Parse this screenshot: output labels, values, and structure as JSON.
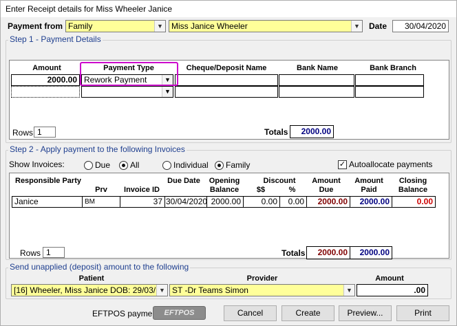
{
  "window": {
    "title": "Enter Receipt details for Miss  Wheeler  Janice"
  },
  "header": {
    "payment_from_label": "Payment from",
    "payment_from_value": "Family",
    "patient_value": "Miss Janice  Wheeler",
    "date_label": "Date",
    "date_value": "30/04/2020"
  },
  "step1": {
    "title": "Step 1 - Payment Details",
    "columns": [
      "Amount",
      "Payment Type",
      "Cheque/Deposit Name",
      "Bank Name",
      "Bank Branch"
    ],
    "row1": {
      "amount": "2000.00",
      "payment_type": "Rework Payment",
      "cheque_name": "",
      "bank_name": "",
      "bank_branch": ""
    },
    "rows_label": "Rows",
    "rows_value": "1",
    "totals_label": "Totals",
    "totals_value": "2000.00"
  },
  "step2": {
    "title": "Step 2 - Apply payment to the following Invoices",
    "show_invoices_label": "Show Invoices:",
    "radio_due": "Due",
    "radio_all": "All",
    "radio_individual": "Individual",
    "radio_family": "Family",
    "autoallocate_label": "Autoallocate payments",
    "columns": {
      "responsible_party": "Responsible Party",
      "prv": "Prv",
      "invoice_id": "Invoice ID",
      "due_date": "Due Date",
      "opening_balance": "Opening Balance",
      "discount": "Discount",
      "discount_dollar": "$$",
      "discount_pct": "%",
      "amount_due": "Amount Due",
      "amount_paid": "Amount Paid",
      "closing_balance": "Closing Balance"
    },
    "rows": [
      {
        "party": "Janice",
        "prv": "BM",
        "invoice_id": "37",
        "due_date": "30/04/2020",
        "opening_balance": "2000.00",
        "discount_dollar": "0.00",
        "discount_pct": "0.00",
        "amount_due": "2000.00",
        "amount_paid": "2000.00",
        "closing_balance": "0.00"
      }
    ],
    "rows_label": "Rows",
    "rows_value": "1",
    "totals_label": "Totals",
    "totals_due": "2000.00",
    "totals_paid": "2000.00"
  },
  "unapplied": {
    "title": "Send unapplied (deposit) amount to the following",
    "patient_header": "Patient",
    "provider_header": "Provider",
    "amount_header": "Amount",
    "patient_value": "[16] Wheeler, Miss Janice DOB: 29/03/",
    "provider_value": "ST -Dr Teams Simon",
    "amount_value": ".00"
  },
  "footer": {
    "eftpos_label": "EFTPOS payment",
    "eftpos_button_text": "EFTPOS",
    "cancel": "Cancel",
    "create": "Create",
    "preview": "Preview...",
    "print": "Print"
  },
  "colors": {
    "highlight": "#cc00cc",
    "yellow": "#ffff99",
    "group_title": "#1f3f8f",
    "amount_due": "#800000",
    "amount_paid": "#000080",
    "closing": "#cc0000"
  }
}
